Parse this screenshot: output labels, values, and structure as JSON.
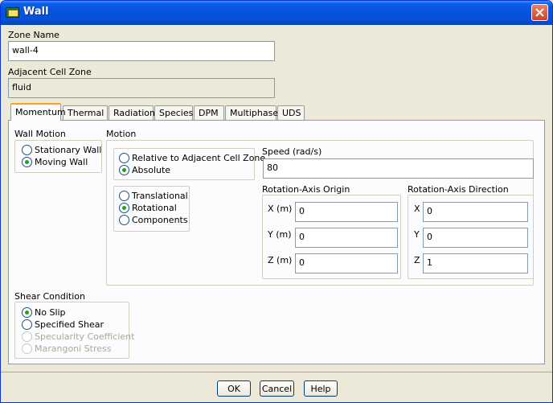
{
  "window": {
    "title": "Wall"
  },
  "zone": {
    "label": "Zone Name",
    "value": "wall-4"
  },
  "adjacent": {
    "label": "Adjacent Cell Zone",
    "value": "fluid"
  },
  "tabs": [
    {
      "label": "Momentum",
      "active": true
    },
    {
      "label": "Thermal"
    },
    {
      "label": "Radiation"
    },
    {
      "label": "Species"
    },
    {
      "label": "DPM"
    },
    {
      "label": "Multiphase"
    },
    {
      "label": "UDS"
    }
  ],
  "wall_motion": {
    "title": "Wall Motion",
    "options": [
      {
        "label": "Stationary Wall",
        "selected": false
      },
      {
        "label": "Moving Wall",
        "selected": true
      }
    ]
  },
  "motion": {
    "title": "Motion",
    "reference": [
      {
        "label": "Relative to Adjacent Cell Zone",
        "selected": false
      },
      {
        "label": "Absolute",
        "selected": true
      }
    ],
    "type": [
      {
        "label": "Translational",
        "selected": false
      },
      {
        "label": "Rotational",
        "selected": true
      },
      {
        "label": "Components",
        "selected": false
      }
    ],
    "speed": {
      "label": "Speed (rad/s)",
      "value": "80"
    },
    "origin": {
      "title": "Rotation-Axis Origin",
      "x_label": "X (m)",
      "x": "0",
      "y_label": "Y (m)",
      "y": "0",
      "z_label": "Z (m)",
      "z": "0"
    },
    "direction": {
      "title": "Rotation-Axis Direction",
      "x_label": "X",
      "x": "0",
      "y_label": "Y",
      "y": "0",
      "z_label": "Z",
      "z": "1"
    }
  },
  "shear": {
    "title": "Shear Condition",
    "options": [
      {
        "label": "No Slip",
        "selected": true,
        "enabled": true
      },
      {
        "label": "Specified Shear",
        "selected": false,
        "enabled": true
      },
      {
        "label": "Specularity Coefficient",
        "selected": false,
        "enabled": false
      },
      {
        "label": "Marangoni Stress",
        "selected": false,
        "enabled": false
      }
    ]
  },
  "buttons": {
    "ok": "OK",
    "cancel": "Cancel",
    "help": "Help"
  },
  "colors": {
    "title_bar": "#0553e0",
    "dialog_bg": "#ece9d8",
    "radio_on": "#21a121",
    "active_tab_accent": "#ff9f1c"
  }
}
